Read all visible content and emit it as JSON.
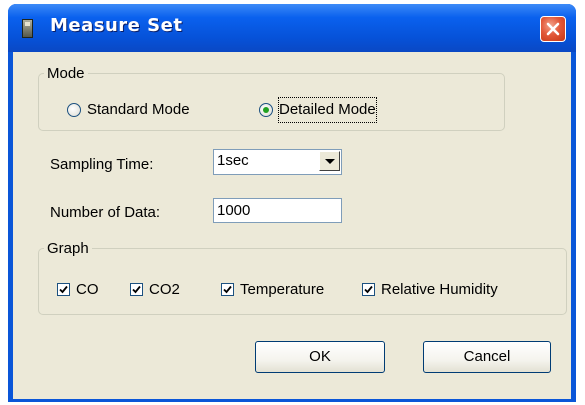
{
  "window": {
    "title": "Measure Set",
    "colors": {
      "titlebar": "#0a56d8",
      "client": "#ece9d8",
      "close": "#e2583a"
    }
  },
  "mode": {
    "legend": "Mode",
    "options": [
      {
        "label": "Standard Mode",
        "checked": false
      },
      {
        "label": "Detailed Mode",
        "checked": true
      }
    ]
  },
  "sampling": {
    "label": "Sampling Time:",
    "value": "1sec"
  },
  "num_data": {
    "label": "Number of Data:",
    "value": "1000"
  },
  "graph": {
    "legend": "Graph",
    "items": [
      {
        "label": "CO",
        "checked": true
      },
      {
        "label": "CO2",
        "checked": true
      },
      {
        "label": "Temperature",
        "checked": true
      },
      {
        "label": "Relative Humidity",
        "checked": true
      }
    ]
  },
  "buttons": {
    "ok": "OK",
    "cancel": "Cancel"
  },
  "icons": {
    "app": "app-icon",
    "close": "close-icon",
    "dropdown": "chevron-down-icon"
  }
}
